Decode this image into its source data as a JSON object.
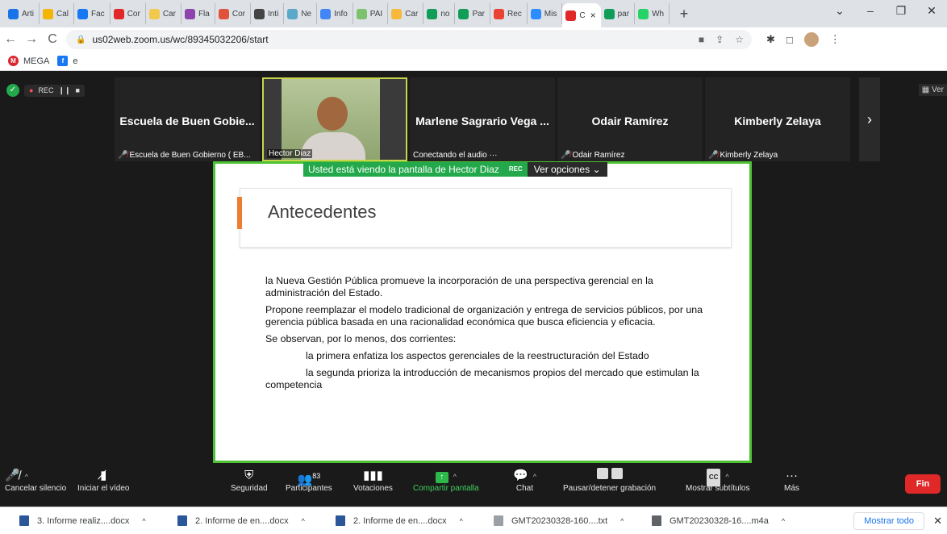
{
  "browser": {
    "tabs": [
      {
        "label": "Arti",
        "color": "#1a73e8"
      },
      {
        "label": "Cal",
        "color": "#f4b400"
      },
      {
        "label": "Fac",
        "color": "#1877f2"
      },
      {
        "label": "Cor",
        "color": "#e02828"
      },
      {
        "label": "Car",
        "color": "#f2c94c"
      },
      {
        "label": "Fla",
        "color": "#8e44ad"
      },
      {
        "label": "Cor",
        "color": "#e0533a"
      },
      {
        "label": "Inti",
        "color": "#444444"
      },
      {
        "label": "Ne",
        "color": "#5aa9c9"
      },
      {
        "label": "Info",
        "color": "#4285f4"
      },
      {
        "label": "PAI",
        "color": "#7cc16b"
      },
      {
        "label": "Car",
        "color": "#f6b93b"
      },
      {
        "label": "no",
        "color": "#0f9d58"
      },
      {
        "label": "Par",
        "color": "#0f9d58"
      },
      {
        "label": "Rec",
        "color": "#ea4335"
      },
      {
        "label": "Mis",
        "color": "#2d8cff"
      },
      {
        "label": "C",
        "color": "#e02828",
        "active": true
      },
      {
        "label": "par",
        "color": "#0f9d58"
      },
      {
        "label": "Wh",
        "color": "#25d366"
      }
    ],
    "url": "us02web.zoom.us/wc/89345032206/start",
    "bookmarks": [
      {
        "label": "MEGA",
        "color": "#d9272e",
        "glyph": "M"
      },
      {
        "label": "e",
        "color": "#1877f2",
        "glyph": "f"
      }
    ]
  },
  "zoom": {
    "rec_label": "REC",
    "view_label": "Ver",
    "participants": [
      {
        "name": "Escuela de Buen Gobie...",
        "label": "Escuela de Buen Gobierno ( EB...",
        "muted": true
      },
      {
        "name": "",
        "label": "Hector Diaz",
        "muted": false,
        "video": true
      },
      {
        "name": "Marlene Sagrario Vega ...",
        "label": "Conectando el audio ···",
        "muted": false
      },
      {
        "name": "Odair Ramírez",
        "label": "Odair Ramírez",
        "muted": true
      },
      {
        "name": "Kimberly Zelaya",
        "label": "Kimberly Zelaya",
        "muted": true
      }
    ],
    "viewing_banner": "Usted está viendo la pantalla de Hector Diaz",
    "viewing_rec": "REC",
    "view_options": "Ver opciones",
    "slide": {
      "title": "Antecedentes",
      "paragraphs": [
        "la Nueva Gestión Pública promueve la incorporación de una perspectiva gerencial en la administración del Estado.",
        "Propone reemplazar el modelo tradicional de organización y entrega de servicios públicos, por una gerencia pública basada en una racionalidad económica que busca eficiencia y eficacia.",
        "Se observan, por lo menos, dos corrientes:",
        "la primera enfatiza los aspectos gerenciales de la           reestructuración del Estado",
        "la segunda prioriza la introducción de mecanismos propios del    mercado que estimulan la competencia"
      ]
    },
    "controls": {
      "mute": "Cancelar silencio",
      "video": "Iniciar el vídeo",
      "security": "Seguridad",
      "participants": "Participantes",
      "participants_count": "83",
      "polls": "Votaciones",
      "share": "Compartir pantalla",
      "chat": "Chat",
      "record": "Pausar/detener grabación",
      "captions": "Mostrar subtítulos",
      "captions_badge": "CC",
      "more": "Más",
      "end": "Fin"
    }
  },
  "downloads": {
    "items": [
      {
        "label": "3. Informe realiz....docx",
        "color": "#2b579a"
      },
      {
        "label": "2. Informe de en....docx",
        "color": "#2b579a"
      },
      {
        "label": "2. Informe de en....docx",
        "color": "#2b579a"
      },
      {
        "label": "GMT20230328-160....txt",
        "color": "#9aa0a6"
      },
      {
        "label": "GMT20230328-16....m4a",
        "color": "#5f6368"
      }
    ],
    "show_all": "Mostrar todo"
  }
}
